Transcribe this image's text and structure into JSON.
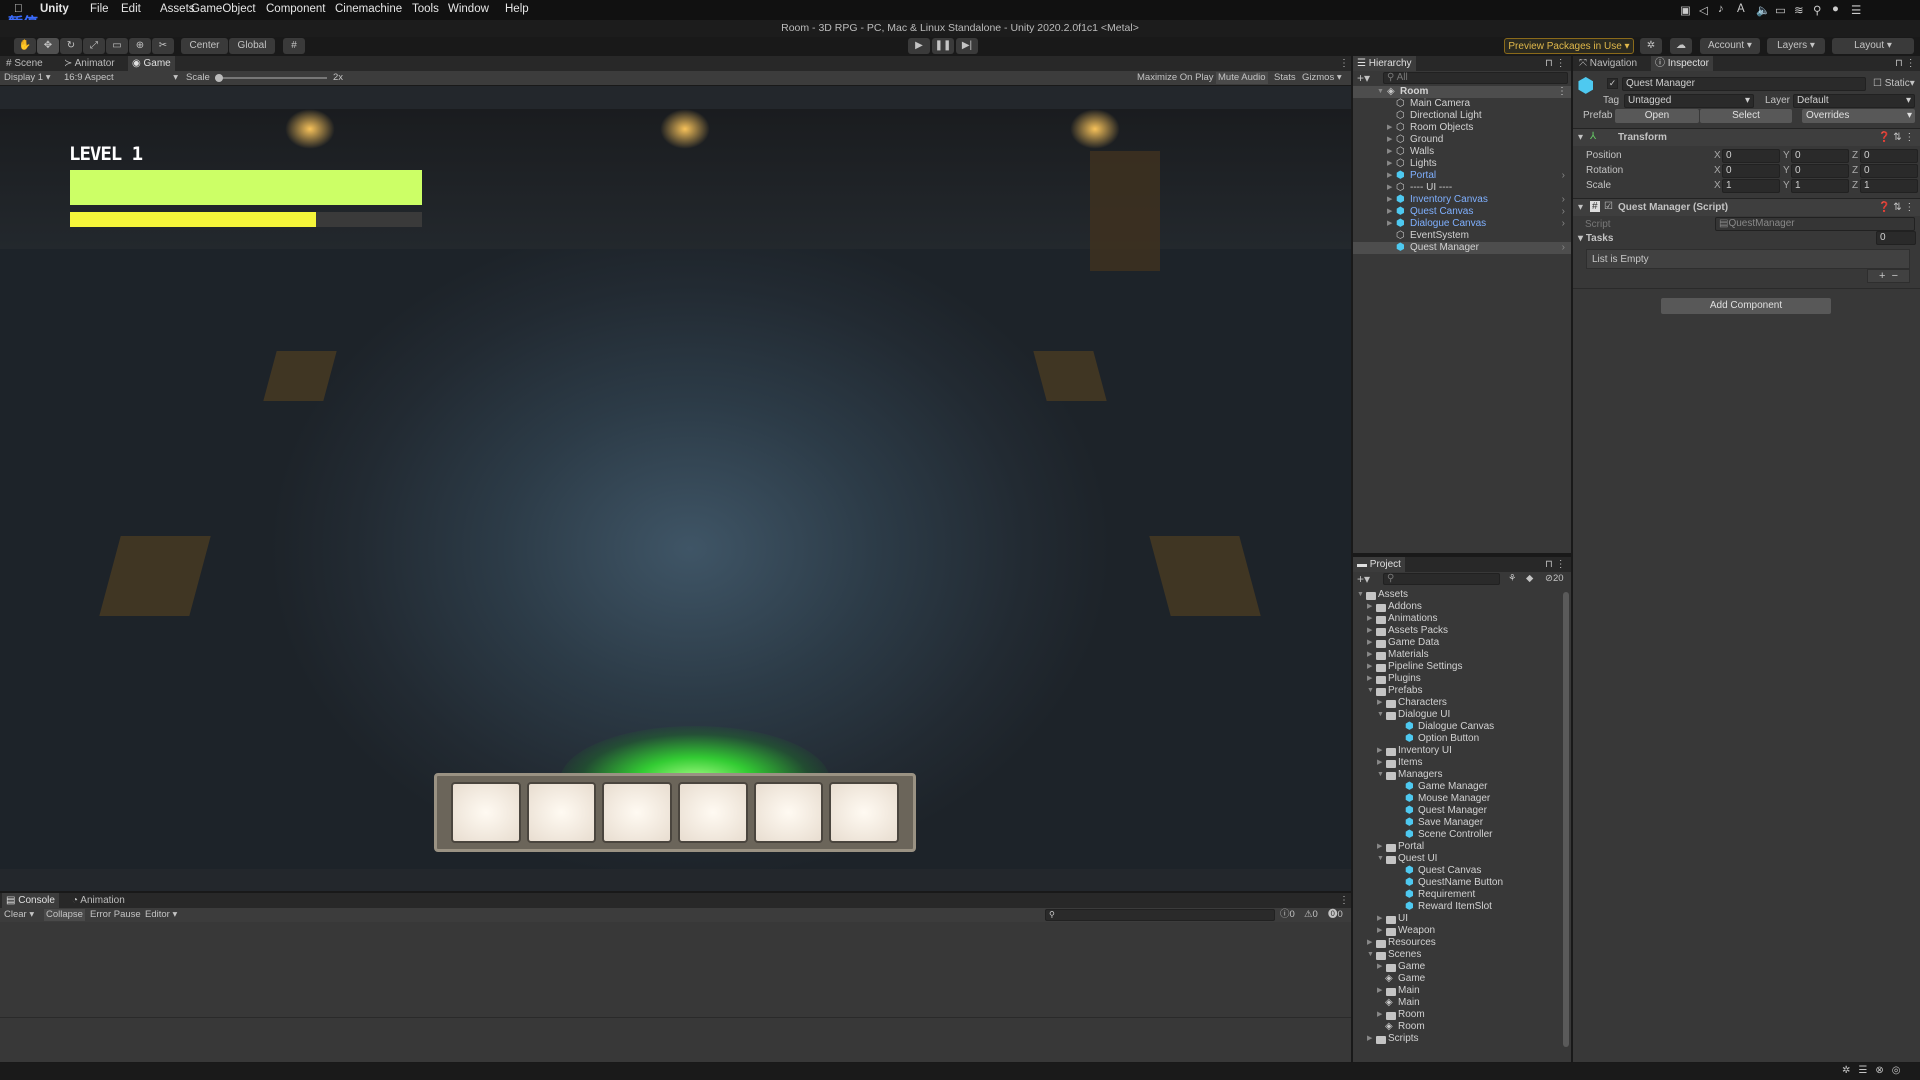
{
  "menubar": {
    "apple": "",
    "app": "Unity",
    "items": [
      "File",
      "Edit",
      "Assets",
      "GameObject",
      "Component",
      "Cinemachine",
      "Tools",
      "Window",
      "Help"
    ],
    "overlay_text": "暂停",
    "status_icons": [
      "screen-record-icon",
      "bluetooth-icon",
      "sound-icon",
      "input-source-icon",
      "volume-icon",
      "airplay-icon",
      "wifi-icon",
      "spotlight-icon",
      "siri-icon",
      "control-center-icon"
    ]
  },
  "window": {
    "title": "Room - 3D RPG - PC, Mac & Linux Standalone - Unity 2020.2.0f1c1 <Metal>"
  },
  "toolbar": {
    "tools": [
      "hand-tool",
      "move-tool",
      "rotate-tool",
      "scale-tool",
      "rect-tool",
      "transform-tool",
      "custom-tool"
    ],
    "pivot": "Center",
    "space": "Global",
    "preview_packages": "Preview Packages in Use",
    "account": "Account",
    "layers": "Layers",
    "layout": "Layout"
  },
  "game_tabs": [
    "Scene",
    "Animator",
    "Game"
  ],
  "game_toolbar": {
    "display": "Display 1",
    "aspect": "16:9 Aspect",
    "scale_label": "Scale",
    "scale_value": "2x",
    "maximize": "Maximize On Play",
    "mute": "Mute Audio",
    "stats": "Stats",
    "gizmos": "Gizmos"
  },
  "game": {
    "level_text": "LEVEL 1",
    "health_fill": 1.0,
    "exp_fill": 0.7,
    "health_color": "#ccff66",
    "exp_color": "#f5f53a",
    "inventory_slots": 6
  },
  "console": {
    "tabs": [
      "Console",
      "Animation"
    ],
    "clear": "Clear",
    "collapse": "Collapse",
    "error_pause": "Error Pause",
    "editor": "Editor",
    "log_count": "0",
    "warn_count": "0",
    "error_count": "0"
  },
  "hierarchy": {
    "title": "Hierarchy",
    "search_placeholder": "All",
    "root": "Room",
    "items": [
      {
        "label": "Main Camera",
        "prefab": false,
        "expand": false
      },
      {
        "label": "Directional Light",
        "prefab": false,
        "expand": false
      },
      {
        "label": "Room Objects",
        "prefab": false,
        "expand": true
      },
      {
        "label": "Ground",
        "prefab": false,
        "expand": true
      },
      {
        "label": "Walls",
        "prefab": false,
        "expand": true
      },
      {
        "label": "Lights",
        "prefab": false,
        "expand": true
      },
      {
        "label": "Portal",
        "prefab": true,
        "expand": true
      },
      {
        "label": "---- UI ----",
        "prefab": false,
        "expand": true
      },
      {
        "label": "Inventory Canvas",
        "prefab": true,
        "expand": true
      },
      {
        "label": "Quest Canvas",
        "prefab": true,
        "expand": true
      },
      {
        "label": "Dialogue Canvas",
        "prefab": true,
        "expand": true
      },
      {
        "label": "EventSystem",
        "prefab": false,
        "expand": false
      },
      {
        "label": "Quest Manager",
        "prefab": true,
        "expand": false,
        "selected": true
      }
    ]
  },
  "inspector": {
    "tabs": [
      "Navigation",
      "Inspector"
    ],
    "object_name": "Quest Manager",
    "static_label": "Static",
    "tag_label": "Tag",
    "tag": "Untagged",
    "layer_label": "Layer",
    "layer": "Default",
    "prefab_label": "Prefab",
    "open": "Open",
    "select": "Select",
    "overrides": "Overrides",
    "transform": {
      "title": "Transform",
      "rows": [
        {
          "label": "Position",
          "x": "0",
          "y": "0",
          "z": "0"
        },
        {
          "label": "Rotation",
          "x": "0",
          "y": "0",
          "z": "0"
        },
        {
          "label": "Scale",
          "x": "1",
          "y": "1",
          "z": "1"
        }
      ]
    },
    "script": {
      "title": "Quest Manager (Script)",
      "script_label": "Script",
      "script_value": "QuestManager",
      "tasks_label": "Tasks",
      "tasks_count": "0",
      "empty": "List is Empty",
      "plus": "+",
      "minus": "−"
    },
    "add_component": "Add Component"
  },
  "project": {
    "title": "Project",
    "hidden_count": "20",
    "items": [
      {
        "label": "Assets",
        "depth": 0,
        "type": "open"
      },
      {
        "label": "Addons",
        "depth": 1,
        "type": "folder"
      },
      {
        "label": "Animations",
        "depth": 1,
        "type": "folder"
      },
      {
        "label": "Assets Packs",
        "depth": 1,
        "type": "folder"
      },
      {
        "label": "Game Data",
        "depth": 1,
        "type": "folder"
      },
      {
        "label": "Materials",
        "depth": 1,
        "type": "folder"
      },
      {
        "label": "Pipeline Settings",
        "depth": 1,
        "type": "folder"
      },
      {
        "label": "Plugins",
        "depth": 1,
        "type": "folder"
      },
      {
        "label": "Prefabs",
        "depth": 1,
        "type": "open"
      },
      {
        "label": "Characters",
        "depth": 2,
        "type": "folder"
      },
      {
        "label": "Dialogue UI",
        "depth": 2,
        "type": "open"
      },
      {
        "label": "Dialogue Canvas",
        "depth": 3,
        "type": "prefab"
      },
      {
        "label": "Option Button",
        "depth": 3,
        "type": "prefab"
      },
      {
        "label": "Inventory UI",
        "depth": 2,
        "type": "folder"
      },
      {
        "label": "Items",
        "depth": 2,
        "type": "folder"
      },
      {
        "label": "Managers",
        "depth": 2,
        "type": "open"
      },
      {
        "label": "Game Manager",
        "depth": 3,
        "type": "prefab"
      },
      {
        "label": "Mouse Manager",
        "depth": 3,
        "type": "prefab"
      },
      {
        "label": "Quest Manager",
        "depth": 3,
        "type": "prefab"
      },
      {
        "label": "Save Manager",
        "depth": 3,
        "type": "prefab"
      },
      {
        "label": "Scene Controller",
        "depth": 3,
        "type": "prefab"
      },
      {
        "label": "Portal",
        "depth": 2,
        "type": "folder"
      },
      {
        "label": "Quest UI",
        "depth": 2,
        "type": "open"
      },
      {
        "label": "Quest Canvas",
        "depth": 3,
        "type": "prefab"
      },
      {
        "label": "QuestName Button",
        "depth": 3,
        "type": "prefab"
      },
      {
        "label": "Requirement",
        "depth": 3,
        "type": "prefab"
      },
      {
        "label": "Reward ItemSlot",
        "depth": 3,
        "type": "prefab"
      },
      {
        "label": "UI",
        "depth": 2,
        "type": "folder"
      },
      {
        "label": "Weapon",
        "depth": 2,
        "type": "folder"
      },
      {
        "label": "Resources",
        "depth": 1,
        "type": "folder"
      },
      {
        "label": "Scenes",
        "depth": 1,
        "type": "open"
      },
      {
        "label": "Game",
        "depth": 2,
        "type": "folder"
      },
      {
        "label": "Game",
        "depth": 2,
        "type": "scene"
      },
      {
        "label": "Main",
        "depth": 2,
        "type": "folder"
      },
      {
        "label": "Main",
        "depth": 2,
        "type": "scene"
      },
      {
        "label": "Room",
        "depth": 2,
        "type": "folder"
      },
      {
        "label": "Room",
        "depth": 2,
        "type": "scene"
      },
      {
        "label": "Scripts",
        "depth": 1,
        "type": "folder"
      }
    ]
  }
}
